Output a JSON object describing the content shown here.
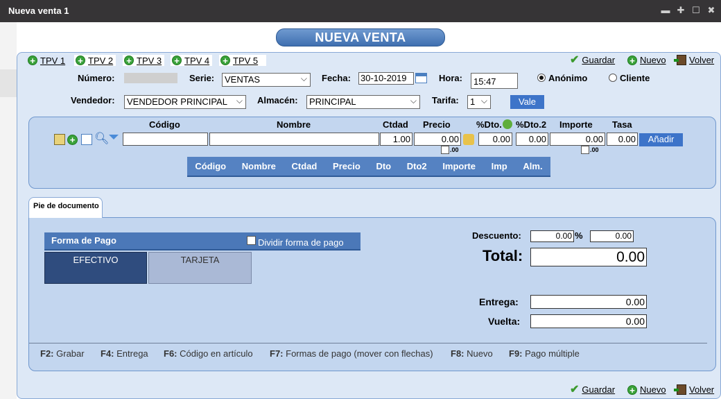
{
  "window": {
    "title": "Nueva venta 1",
    "controls": [
      "minimize-icon",
      "move-icon",
      "maximize-icon",
      "close-icon"
    ]
  },
  "header": {
    "title": "NUEVA VENTA"
  },
  "tabs": [
    "TPV 1",
    "TPV 2",
    "TPV 3",
    "TPV 4",
    "TPV 5"
  ],
  "actions": {
    "save": "Guardar",
    "new": "Nuevo",
    "back": "Volver"
  },
  "form": {
    "numero_label": "Número:",
    "serie_label": "Serie:",
    "serie_value": "VENTAS",
    "fecha_label": "Fecha:",
    "fecha_value": "30-10-2019",
    "hora_label": "Hora:",
    "hora_value": "15:47",
    "anonimo_label": "Anónimo",
    "cliente_label": "Cliente",
    "vendedor_label": "Vendedor:",
    "vendedor_value": "VENDEDOR PRINCIPAL",
    "almacen_label": "Almacén:",
    "almacen_value": "PRINCIPAL",
    "tarifa_label": "Tarifa:",
    "tarifa_value": "1",
    "vale_button": "Vale"
  },
  "product_entry": {
    "headers": {
      "codigo": "Código",
      "nombre": "Nombre",
      "ctdad": "Ctdad",
      "precio": "Precio",
      "dto": "%Dto.",
      "dto2": "%Dto.2",
      "importe": "Importe",
      "tasa": "Tasa"
    },
    "values": {
      "codigo": "",
      "nombre": "",
      "ctdad": "1.00",
      "precio": "0.00",
      "dto": "0.00",
      "dto2": "0.00",
      "importe": "0.00",
      "tasa": "0.00"
    },
    "decimals_suffix": ".00",
    "add_button": "Añadir"
  },
  "lines_table": {
    "columns": [
      "Código",
      "Nombre",
      "Ctdad",
      "Precio",
      "Dto",
      "Dto2",
      "Importe",
      "Imp",
      "Alm."
    ]
  },
  "footer_tab": "Pie de documento",
  "payment": {
    "title": "Forma de Pago",
    "split_label": "Dividir forma de pago",
    "methods": [
      "EFECTIVO",
      "TARJETA"
    ]
  },
  "totals": {
    "descuento_label": "Descuento:",
    "descuento_pct": "0.00",
    "pct_sign": "%",
    "descuento_amount": "0.00",
    "total_label": "Total:",
    "total_value": "0.00",
    "entrega_label": "Entrega:",
    "entrega_value": "0.00",
    "vuelta_label": "Vuelta:",
    "vuelta_value": "0.00"
  },
  "shortcuts": [
    {
      "key": "F2:",
      "text": "Grabar"
    },
    {
      "key": "F4:",
      "text": "Entrega"
    },
    {
      "key": "F6:",
      "text": "Código en artículo"
    },
    {
      "key": "F7:",
      "text": "Formas de pago (mover con flechas)"
    },
    {
      "key": "F8:",
      "text": "Nuevo"
    },
    {
      "key": "F9:",
      "text": "Pago múltiple"
    }
  ],
  "colors": {
    "titlebar": "#363436",
    "panel": "#dde8f6",
    "subpanel": "#c3d6ef",
    "accent": "#3d74c9",
    "selected_method": "#2f4c7e"
  }
}
